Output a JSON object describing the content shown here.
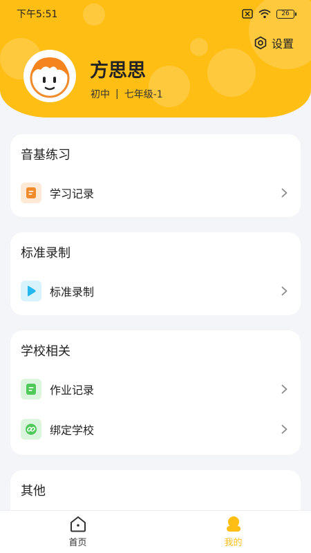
{
  "status_bar": {
    "time": "下午5:51",
    "battery": "26"
  },
  "header": {
    "settings_label": "设置",
    "user": {
      "name": "方思思",
      "level": "初中",
      "separator": "|",
      "grade": "七年级-1"
    }
  },
  "sections": [
    {
      "title": "音基练习",
      "items": [
        {
          "label": "学习记录",
          "icon": "document-icon",
          "color": "#f08a2a",
          "bg": "#fde9d6"
        }
      ]
    },
    {
      "title": "标准录制",
      "items": [
        {
          "label": "标准录制",
          "icon": "play-icon",
          "color": "#25b8f0",
          "bg": "#d9f3fd"
        }
      ]
    },
    {
      "title": "学校相关",
      "items": [
        {
          "label": "作业记录",
          "icon": "document-icon",
          "color": "#4fc95a",
          "bg": "#dcf5de"
        },
        {
          "label": "绑定学校",
          "icon": "link-icon",
          "color": "#4fc95a",
          "bg": "#dcf5de"
        }
      ]
    },
    {
      "title": "其他",
      "items": []
    }
  ],
  "tabbar": {
    "tabs": [
      {
        "label": "首页",
        "icon": "home-icon",
        "active": false
      },
      {
        "label": "我的",
        "icon": "user-icon",
        "active": true
      }
    ],
    "active_color": "#ffbe14",
    "inactive_color": "#333333"
  },
  "colors": {
    "brand": "#ffbe14",
    "background": "#f4f5f9"
  }
}
